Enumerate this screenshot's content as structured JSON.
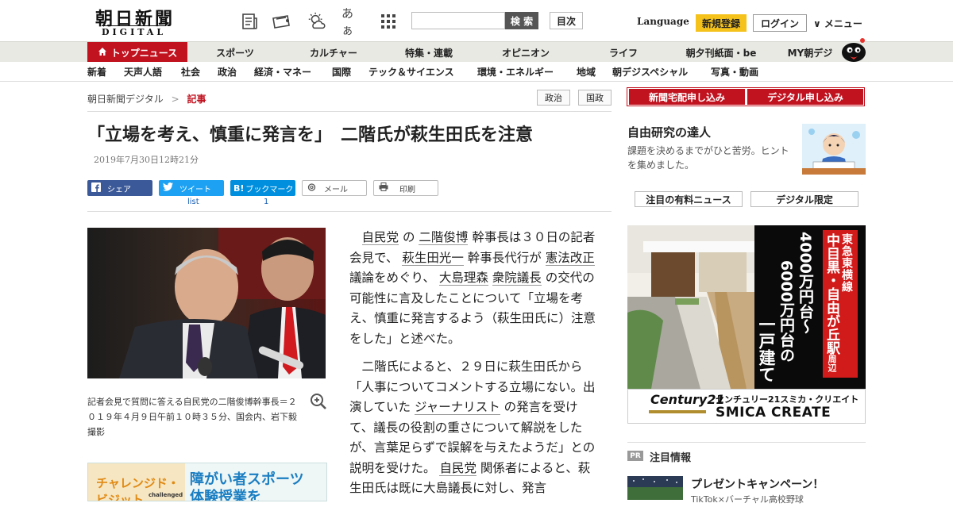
{
  "header": {
    "logo_jp": "朝日新聞",
    "logo_en": "DIGITAL",
    "icons": [
      "newspaper-icon",
      "coupon-icon",
      "weather-icon",
      "font-size-icon",
      "apps-grid-icon"
    ],
    "font_icon_label": "あぁ",
    "search_placeholder": "",
    "search_button": "検 索",
    "toc_button": "目次",
    "language": "Language",
    "signup": "新規登録",
    "login": "ログイン",
    "menu": "∨ メニュー"
  },
  "nav_primary": {
    "items": [
      "トップニュース",
      "スポーツ",
      "カルチャー",
      "特集・連載",
      "オピニオン",
      "ライフ",
      "朝夕刊紙面・be",
      "MY朝デジ"
    ],
    "active": "トップニュース"
  },
  "nav_secondary": {
    "items": [
      "新着",
      "天声人語",
      "社会",
      "政治",
      "経済・マネー",
      "国際",
      "テック＆サイエンス",
      "環境・エネルギー",
      "地域",
      "朝デジスペシャル",
      "写真・動画"
    ]
  },
  "breadcrumb": {
    "home": "朝日新聞デジタル",
    "separator": ">",
    "current": "記事"
  },
  "tags": [
    "政治",
    "国政"
  ],
  "article": {
    "title": "「立場を考え、慎重に発言を」　二階氏が萩生田氏を注意",
    "date": "2019年7月30日12時21分",
    "share": {
      "facebook": "シェア",
      "twitter": "ツイート",
      "twitter_count": "list",
      "hatena": "ブックマーク",
      "hatena_count": "1",
      "mail": "メール",
      "print": "印刷"
    },
    "photo_caption": "記者会見で質問に答える自民党の二階俊博幹事長＝２０１９年４月９日午前１０時３５分、国会内、岩下毅撮影",
    "paragraph1": {
      "s1": "自民党",
      "s2": " の ",
      "s3": "二階俊博",
      "s4": " 幹事長は３０日の記者会見で、 ",
      "s5": "萩生田光一",
      "s6": " 幹事長代行が ",
      "s7": "憲法改正",
      "s8": " 議論をめぐり、 ",
      "s9": "大島理森",
      "s10": " ",
      "s11": "衆院議長",
      "s12": " の交代の可能性に言及したことについて「立場を考え、慎重に発言するよう（萩生田氏に）注意をした」と述べた。"
    },
    "paragraph2": {
      "s1": "二階氏によると、２９日に萩生田氏から「人事についてコメントする立場にない。出演していた ",
      "s2": "ジャーナリスト",
      "s3": " の発言を受けて、議長の役割の重さについて解説をしたが、言葉足らずで誤解を与えたようだ」との説明を受けた。 ",
      "s4": "自民党",
      "s5": " 関係者によると、萩生田氏は既に大島議長に対し、発言"
    },
    "promo": {
      "line1": "チャレンジド・",
      "line2": "ビジット",
      "badge": "challenged",
      "head1": "障がい者スポーツ",
      "head2": "体験授業を"
    }
  },
  "sidebar": {
    "buttons": [
      "新聞宅配申し込み",
      "デジタル申し込み"
    ],
    "feature": {
      "title": "自由研究の達人",
      "desc": "課題を決めるまでがひと苦労。ヒントを集めました。"
    },
    "tabs": [
      "注目の有料ニュース",
      "デジタル限定"
    ],
    "ad": {
      "line_a": "東急東横線",
      "line_b": "中目黒・自由が丘駅",
      "line_b_small": "周辺",
      "price1": "4000万円台～",
      "price2": "6000万円台の",
      "type": "一戸建て",
      "brand_logo": "Century21",
      "brand_name": "センチュリー21スミカ・クリエイト",
      "brand_en": "SMICA CREATE"
    },
    "pr": {
      "badge": "PR",
      "title": "注目情報",
      "headline": "プレゼントキャンペーン！",
      "sub": "TikTok×バーチャル高校野球"
    }
  },
  "colors": {
    "brand_red": "#c1121f",
    "signup_yellow": "#f5c21c",
    "twitter": "#1da1f2",
    "facebook": "#3b5998",
    "hatena": "#008fde"
  }
}
